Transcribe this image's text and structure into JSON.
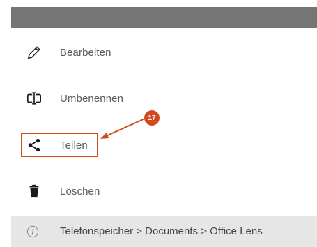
{
  "menu": {
    "items": [
      {
        "label": "Bearbeiten",
        "icon": "pencil-icon"
      },
      {
        "label": "Umbenennen",
        "icon": "rename-icon"
      },
      {
        "label": "Teilen",
        "icon": "share-icon"
      },
      {
        "label": "Löschen",
        "icon": "trash-icon"
      }
    ]
  },
  "footer": {
    "icon": "info-icon",
    "path": "Telefonspeicher > Documents > Office Lens"
  },
  "callout": {
    "number": "17",
    "color": "#d2491d"
  },
  "colors": {
    "topbar": "#757575",
    "footer_bg": "#e6e6e6",
    "icon": "#1a1a1a",
    "label": "#5a5a5a"
  }
}
